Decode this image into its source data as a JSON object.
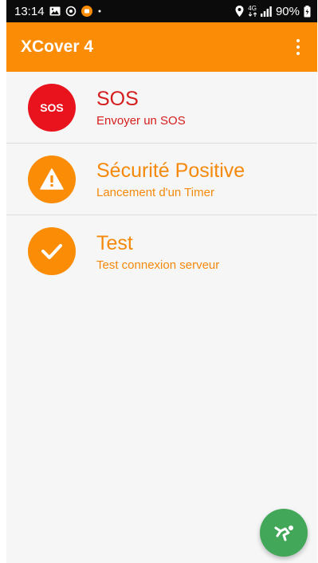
{
  "status_bar": {
    "time": "13:14",
    "network": "4G",
    "battery": "90%",
    "icons": [
      "image-icon",
      "sync-icon",
      "app-notification-icon",
      "dot-icon",
      "location-icon",
      "network-4g-icon",
      "signal-icon",
      "battery-icon"
    ]
  },
  "app_bar": {
    "title": "XCover 4",
    "menu_icon": "more-vert-icon"
  },
  "items": [
    {
      "title": "SOS",
      "subtitle": "Envoyer un SOS",
      "icon_text": "SOS",
      "icon_color": "#e8131c",
      "title_color": "#d61d1d"
    },
    {
      "title": "Sécurité Positive",
      "subtitle": "Lancement d'un Timer",
      "icon": "warning-icon",
      "icon_color": "#fb8c06",
      "title_color": "#f5890b"
    },
    {
      "title": "Test",
      "subtitle": "Test connexion serveur",
      "icon": "check-icon",
      "icon_color": "#fb8c06",
      "title_color": "#f5890b"
    }
  ],
  "fab": {
    "icon": "fall-detection-icon",
    "color": "#43a75a"
  },
  "colors": {
    "accent": "#fb8c06",
    "danger": "#e8131c",
    "fab": "#43a75a",
    "background": "#f6f6f6"
  }
}
